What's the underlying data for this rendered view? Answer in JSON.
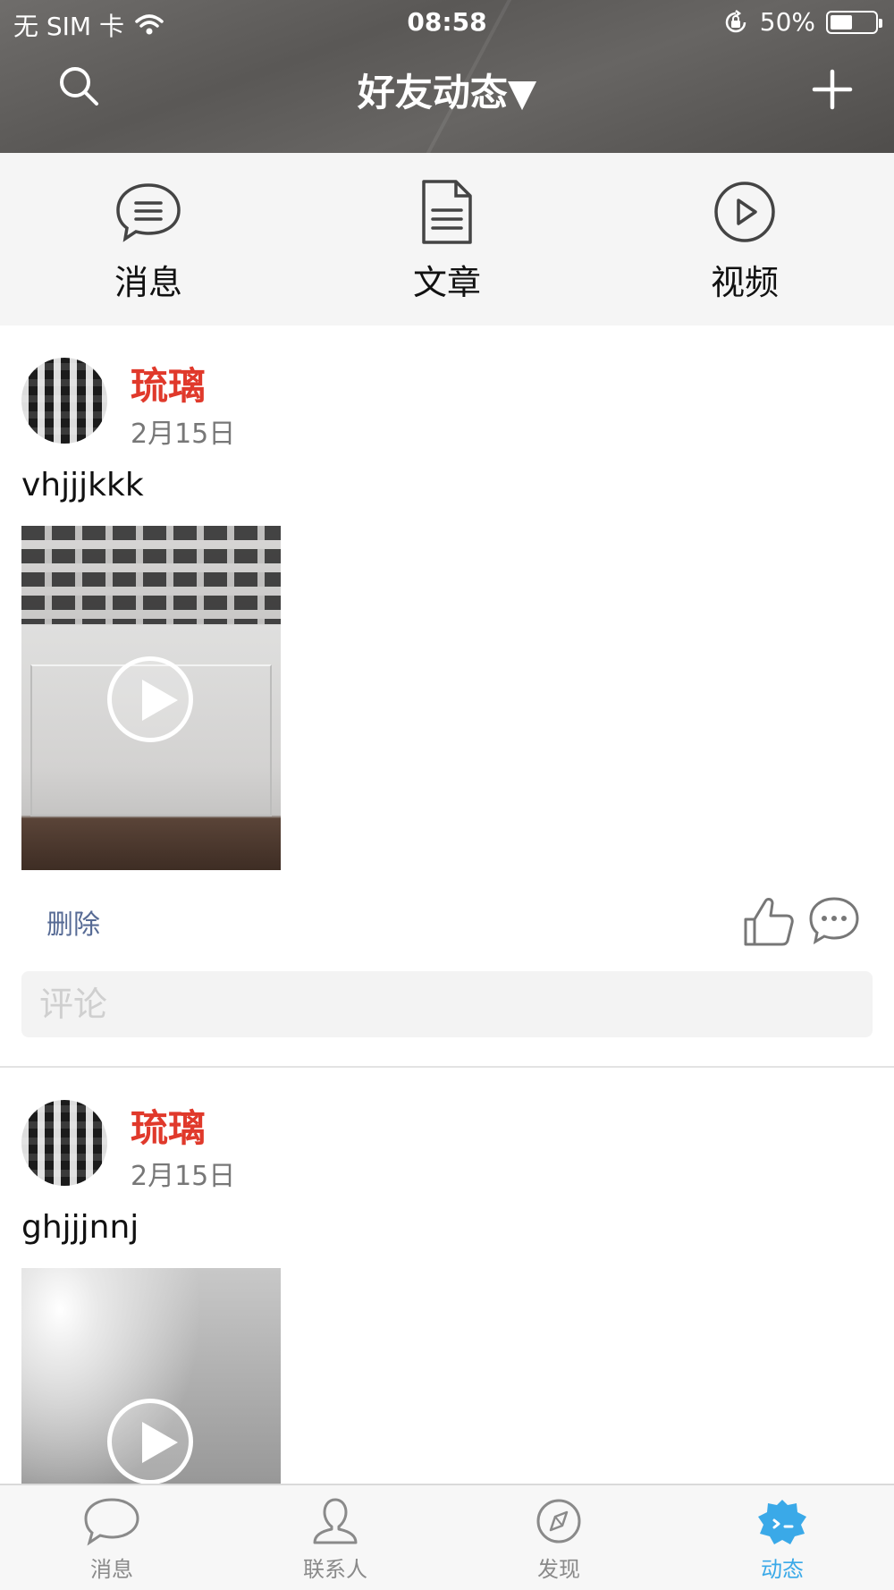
{
  "status_bar": {
    "carrier": "无 SIM 卡",
    "time": "08:58",
    "battery": "50%",
    "battery_level": 0.5
  },
  "nav": {
    "title": "好友动态▼",
    "search_icon": "search-icon",
    "add_icon": "plus-icon"
  },
  "categories": [
    {
      "label": "消息",
      "icon": "chat-bubble-icon"
    },
    {
      "label": "文章",
      "icon": "document-icon"
    },
    {
      "label": "视频",
      "icon": "play-circle-icon"
    }
  ],
  "posts": [
    {
      "author": "琉璃",
      "date": "2月15日",
      "text": "vhjjjkkk",
      "delete_label": "删除",
      "comment_placeholder": "评论"
    },
    {
      "author": "琉璃",
      "date": "2月15日",
      "text": "ghjjjnnj"
    }
  ],
  "tabbar": {
    "items": [
      {
        "label": "消息",
        "icon": "chat-bubble-icon"
      },
      {
        "label": "联系人",
        "icon": "person-icon"
      },
      {
        "label": "发现",
        "icon": "compass-icon"
      },
      {
        "label": "动态",
        "icon": "feed-icon"
      }
    ],
    "active_index": 3,
    "active_color": "#3aa9e8",
    "accent_author_color": "#e0392b",
    "link_color": "#576b95"
  }
}
